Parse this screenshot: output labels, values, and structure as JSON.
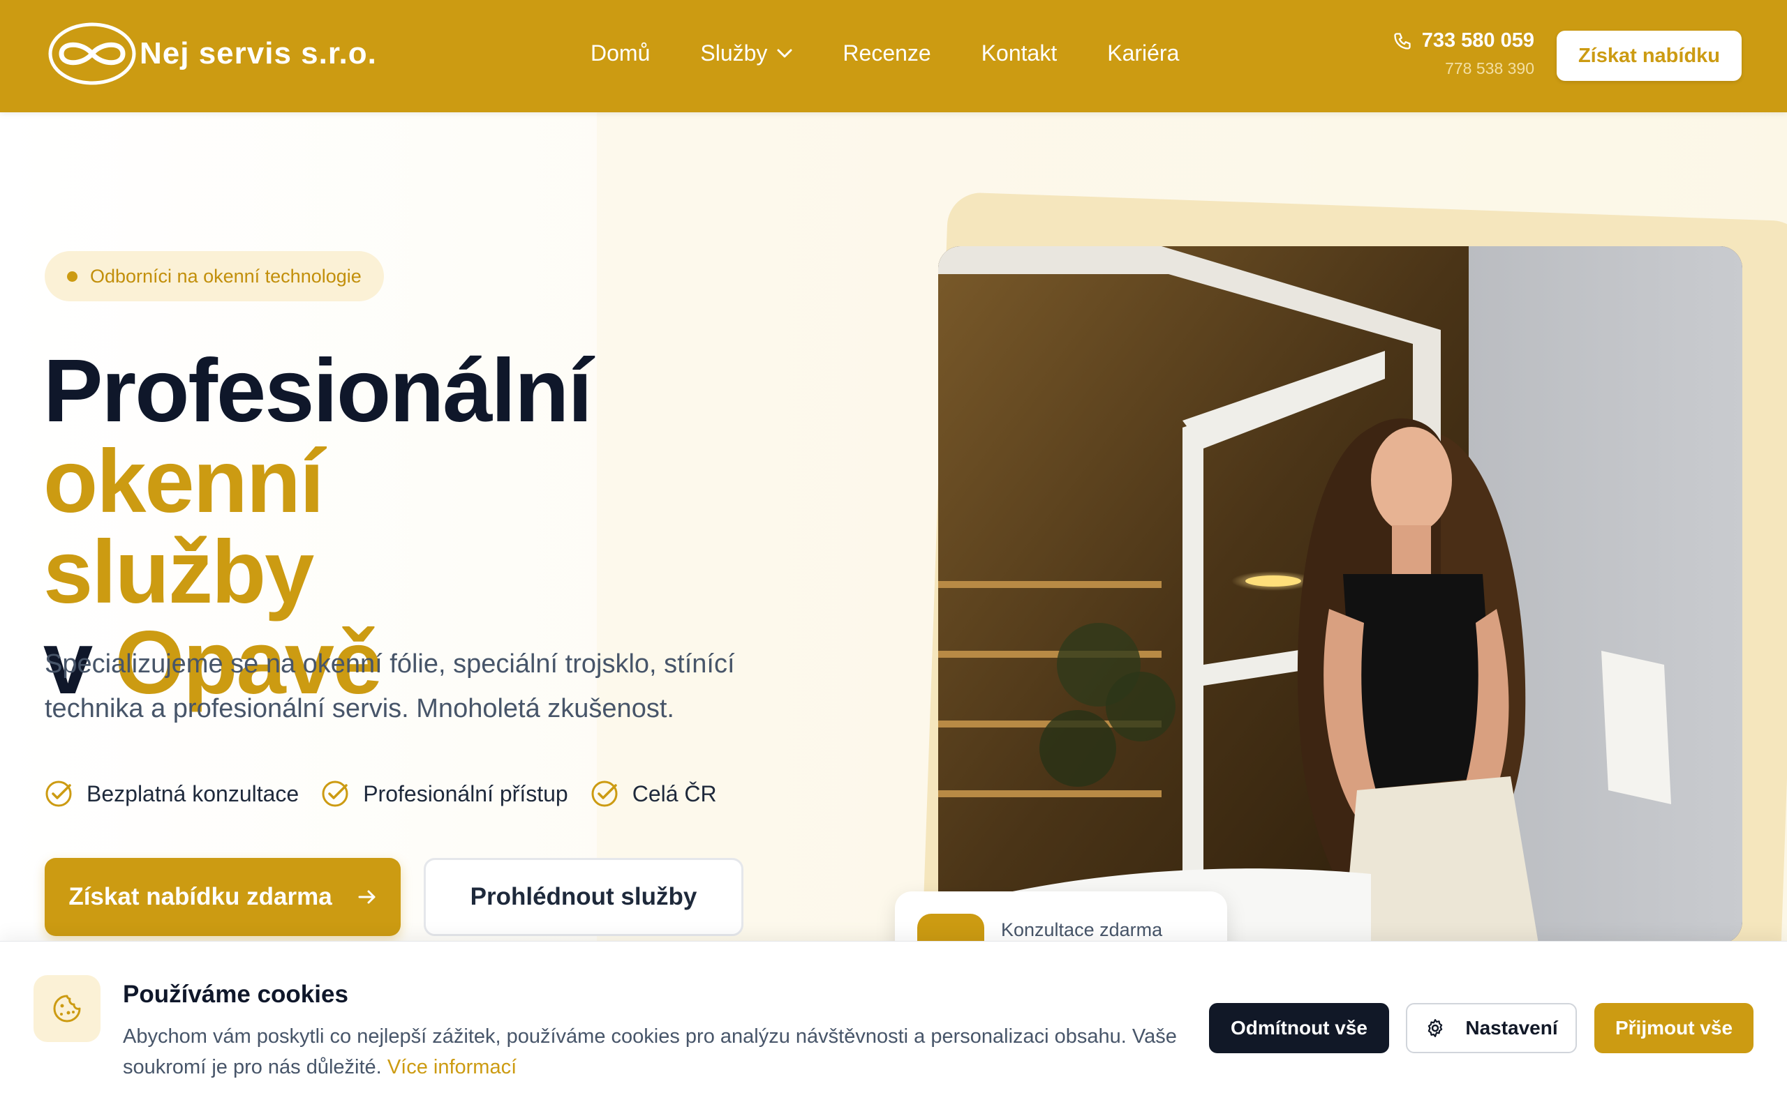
{
  "header": {
    "logo_text": "Nej servis s.r.o.",
    "nav": [
      {
        "label": "Domů"
      },
      {
        "label": "Služby"
      },
      {
        "label": "Recenze"
      },
      {
        "label": "Kontakt"
      },
      {
        "label": "Kariéra"
      }
    ],
    "phone_main": "733 580 059",
    "phone_secondary": "778 538 390",
    "cta_label": "Získat nabídku"
  },
  "hero": {
    "badge": "Odborníci na okenní technologie",
    "title_part1": "Profesionální",
    "title_part2": "okenní",
    "title_part3": "služby",
    "title_part4": "v",
    "title_part5": "Opavě",
    "lead": "Specializujeme se na okenní fólie, speciální trojsklo, stínící technika a profesionální servis. Mnoholetá zkušenost.",
    "features": [
      {
        "label": "Bezplatná konzultace"
      },
      {
        "label": "Profesionální přístup"
      },
      {
        "label": "Celá ČR"
      }
    ],
    "primary_cta": "Získat nabídku zdarma",
    "secondary_cta": "Prohlédnout služby",
    "float_card_text": "Konzultace zdarma"
  },
  "cookie": {
    "title": "Používáme cookies",
    "text": "Abychom vám poskytli co nejlepší zážitek, používáme cookies pro analýzu návštěvnosti a personalizaci obsahu. Vaše soukromí je pro nás důležité.",
    "link": "Více informací",
    "reject_label": "Odmítnout vše",
    "settings_label": "Nastavení",
    "accept_label": "Přijmout vše"
  },
  "colors": {
    "brand_gold": "#cc9b12",
    "dark": "#0f172a",
    "cream": "#fbf1d6"
  }
}
